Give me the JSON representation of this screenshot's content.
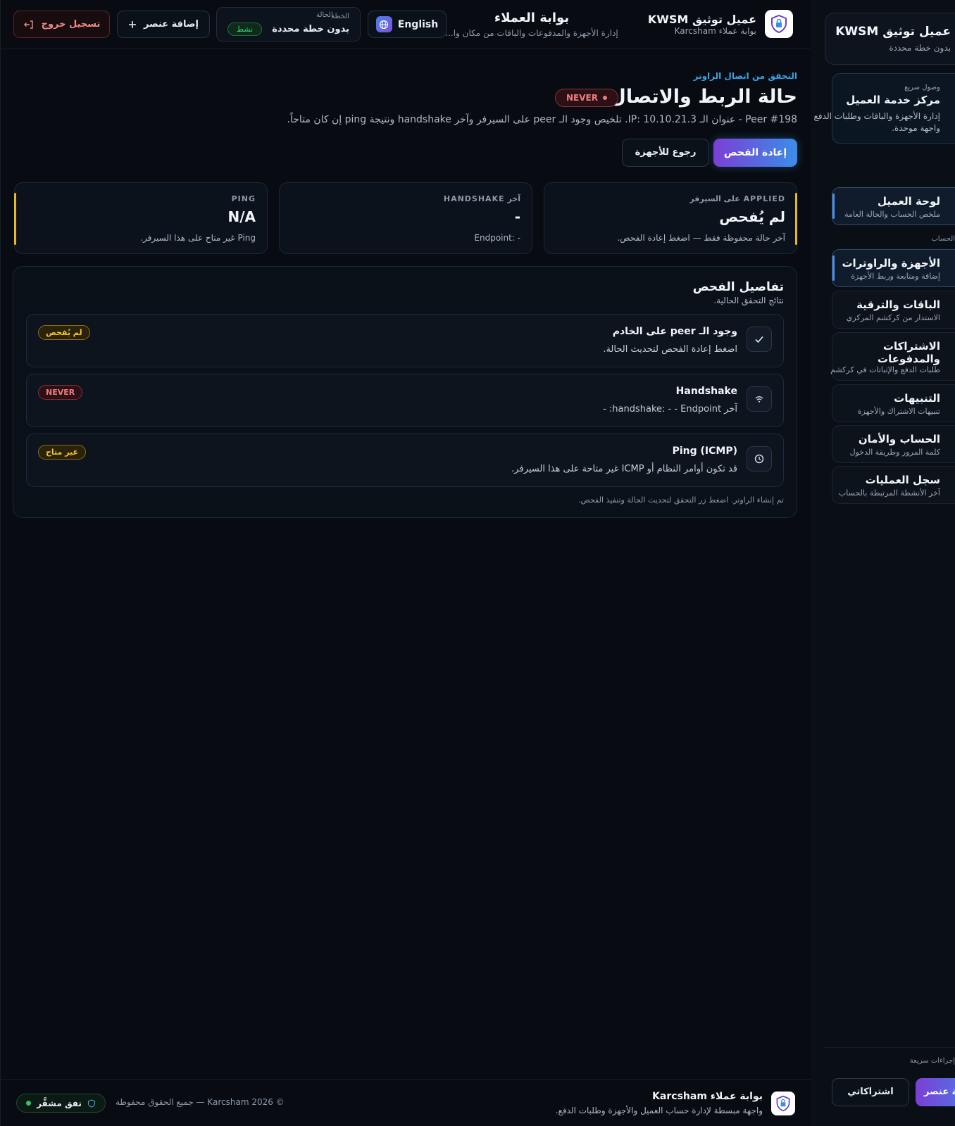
{
  "header": {
    "brand_title": "عميل توثيق KWSM",
    "brand_sub": "بوابة عملاء Karcsham",
    "portal_title": "بوابة العملاء",
    "portal_sub": "إدارة الأجهزة والمدفوعات والباقات من مكان وا...",
    "lang_label": "English",
    "plan_label": "الخطة",
    "plan_value": "بدون خطة محددة",
    "status_label": "الحالة",
    "status_value": "نشط",
    "add_label": "إضافة عنصر",
    "logout_label": "تسجيل خروج"
  },
  "page": {
    "eyebrow": "التحقق من اتصال الراوتر",
    "title": "حالة الربط والاتصال",
    "status_pill": "NEVER",
    "description": "Peer #198 - عنوان الـ IP: 10.10.21.3. تلخيص وجود الـ peer على السيرفر وآخر handshake ونتيجة ping إن كان متاحاً.",
    "recheck_label": "إعادة الفحص",
    "back_label": "رجوع للأجهزة"
  },
  "stats": [
    {
      "label": "APPLIED على السيرفر",
      "value": "لم يُفحص",
      "note": "آخر حالة محفوظة فقط — اضغط إعادة الفحص."
    },
    {
      "label": "آخر HANDSHAKE",
      "value": "-",
      "note": "Endpoint: -"
    },
    {
      "label": "PING",
      "value": "N/A",
      "note": "Ping غير متاح على هذا السيرفر."
    }
  ],
  "details": {
    "title": "تفاصيل الفحص",
    "subtitle": "نتائج التحقق الحالية.",
    "rows": [
      {
        "icon": "check-icon",
        "title": "وجود الـ peer على الخادم",
        "desc": "اضغط إعادة الفحص لتحديث الحالة.",
        "badge": "لم يُفحص"
      },
      {
        "icon": "wifi-icon",
        "title": "Handshake",
        "desc": "آخر handshake: - - Endpoint: -",
        "badge": "NEVER"
      },
      {
        "icon": "clock-icon",
        "title": "Ping (ICMP)",
        "desc": "قد تكون أوامر النظام أو ICMP غير متاحة على هذا السيرفر.",
        "badge": "غير متاح"
      }
    ],
    "footnote": "تم إنشاء الراوتر. اضغط زر التحقق لتحديث الحالة وتنفيذ الفحص."
  },
  "footer": {
    "title": "بوابة عملاء Karcsham",
    "subtitle": "واجهة مبسطة لإدارة حساب العميل والأجهزة وطلبات الدفع.",
    "copyright": "© 2026 Karcsham — جميع الحقوق محفوظة",
    "tunnel_label": "نفق مشفَّر"
  },
  "sidebar": {
    "profile_name": "عميل توثيق KWSM",
    "profile_plan": "بدون خطة محددة",
    "quick_eyebrow": "وصول سريع",
    "quick_title": "مركز خدمة العميل",
    "quick_desc": "إدارة الأجهزة والباقات وطلبات الدفع من واجهة موحدة.",
    "items": [
      {
        "title": "لوحة العميل",
        "sub": "ملخص الحساب والحالة العامة"
      },
      {
        "title": "الأجهزة والراوترات",
        "sub": "إضافة ومتابعة وربط الأجهزة"
      },
      {
        "title": "الباقات والترقية",
        "sub": "الاستدار من كركشم المركزي"
      },
      {
        "title": "الاشتراكات والمدفوعات",
        "sub": "طلبات الدفع والإثباتات في كركشم"
      },
      {
        "title": "التنبيهات",
        "sub": "تنبيهات الاشتراك والأجهزة"
      },
      {
        "title": "الحساب والأمان",
        "sub": "كلمة المرور وطريقة الدخول"
      },
      {
        "title": "سجل العمليات",
        "sub": "آخر الأنشطة المرتبطة بالحساب"
      }
    ],
    "section_label": "الحساب",
    "bottom_label": "إجراءات سريعة",
    "subs_btn": "اشتراكاتي",
    "add_btn": "إضافة عنصر"
  },
  "colors": {
    "accent_blue": "#3aa3e6",
    "accent_purple": "#7b3fd6",
    "warning": "#e8b824",
    "danger": "#f07b7b",
    "success": "#3ccb76"
  }
}
